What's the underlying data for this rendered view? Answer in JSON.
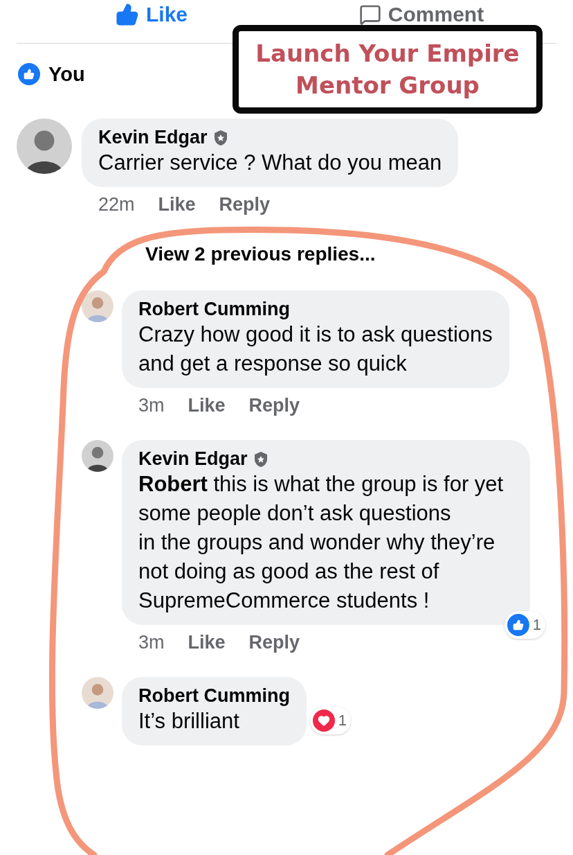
{
  "action_bar": [
    {
      "kind": "like",
      "label": "Like",
      "selected": true
    },
    {
      "kind": "comment",
      "label": "Comment",
      "selected": false
    }
  ],
  "reactions_summary": {
    "kind": "like",
    "label": "You"
  },
  "annotation": {
    "lines": [
      "Launch Your Empire",
      "Mentor Group"
    ]
  },
  "comments": [
    {
      "name": "Kevin Edgar",
      "verified": true,
      "text": "Carrier service ? What do you mean",
      "time": "22m",
      "actions": [
        "Like",
        "Reply"
      ],
      "view_previous": "View 2 previous replies...",
      "children": [
        {
          "name": "Robert Cumming",
          "verified": false,
          "text": "Crazy how good it is to ask questions and get a response so quick",
          "time": "3m",
          "actions": [
            "Like",
            "Reply"
          ]
        },
        {
          "name": "Kevin Edgar",
          "verified": true,
          "text": "**Robert** this is what the group is for yet some people don’t ask questions\n in the groups and wonder why they’re not doing as good as the rest of SupremeCommerce students !",
          "time": "3m",
          "actions": [
            "Like",
            "Reply"
          ],
          "reaction": {
            "kind": "like",
            "count": "1"
          }
        },
        {
          "name": "Robert Cumming",
          "verified": false,
          "text": "It’s brilliant",
          "reaction": {
            "kind": "love",
            "count": "1"
          }
        }
      ]
    }
  ]
}
